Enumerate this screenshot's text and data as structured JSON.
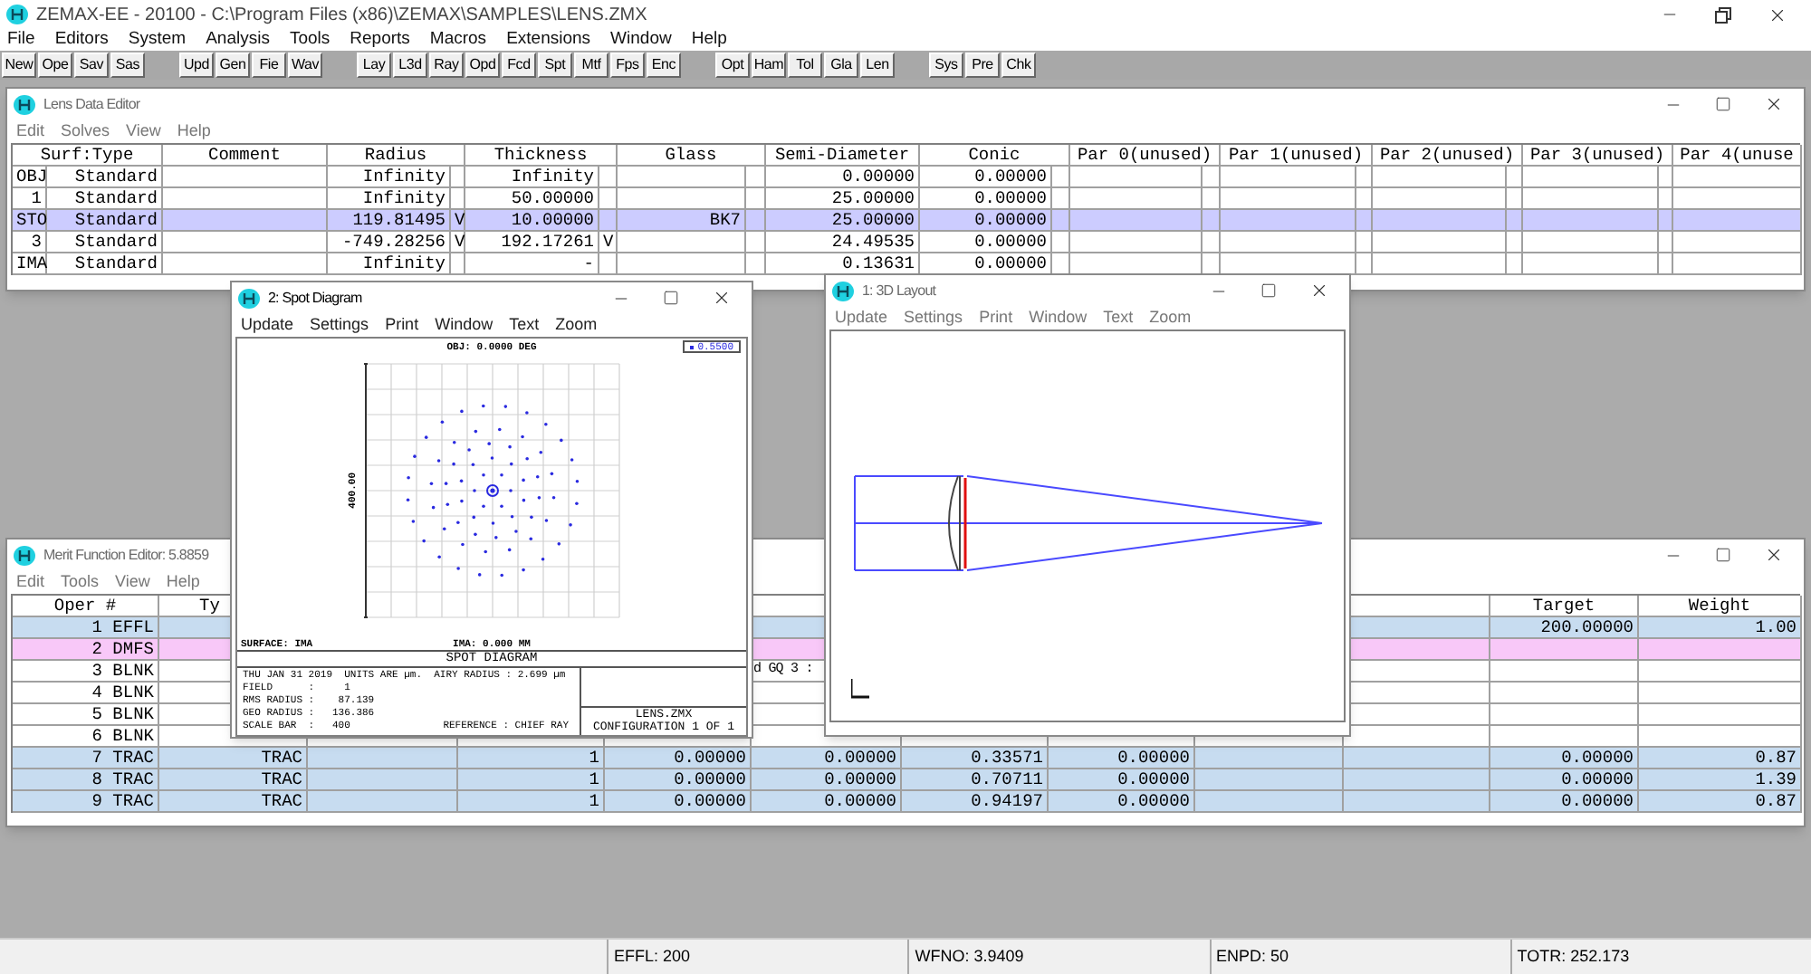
{
  "window": {
    "title": "ZEMAX-EE - 20100 - C:\\Program Files (x86)\\ZEMAX\\SAMPLES\\LENS.ZMX"
  },
  "menu": [
    "File",
    "Editors",
    "System",
    "Analysis",
    "Tools",
    "Reports",
    "Macros",
    "Extensions",
    "Window",
    "Help"
  ],
  "toolbar_groups": [
    {
      "buttons": [
        "New",
        "Ope",
        "Sav",
        "Sas"
      ]
    },
    {
      "buttons": [
        "Upd",
        "Gen",
        "Fie",
        "Wav"
      ]
    },
    {
      "buttons": [
        "Lay",
        "L3d",
        "Ray",
        "Opd",
        "Fcd",
        "Spt",
        "Mtf",
        "Fps",
        "Enc"
      ]
    },
    {
      "buttons": [
        "Opt",
        "Ham",
        "Tol",
        "Gla",
        "Len"
      ]
    },
    {
      "buttons": [
        "Sys",
        "Pre",
        "Chk"
      ]
    }
  ],
  "lens_editor": {
    "title": "Lens Data Editor",
    "active": false,
    "menu": [
      "Edit",
      "Solves",
      "View",
      "Help"
    ],
    "columns": [
      "Surf:Type",
      "Comment",
      "Radius",
      "Thickness",
      "Glass",
      "Semi-Diameter",
      "Conic",
      "Par 0(unused)",
      "Par 1(unused)",
      "Par 2(unused)",
      "Par 3(unused)",
      "Par 4(unuse"
    ],
    "rows": [
      {
        "surface": "OBJ",
        "type": "Standard",
        "radius": "Infinity",
        "thickness": "Infinity",
        "semi_diameter": "0.00000",
        "conic": "0.00000",
        "selected": false
      },
      {
        "surface": "1",
        "type": "Standard",
        "radius": "Infinity",
        "thickness": "50.00000",
        "semi_diameter": "25.00000",
        "conic": "0.00000",
        "selected": false
      },
      {
        "surface": "STO",
        "type": "Standard",
        "radius": "119.81495",
        "radius_solve": "V",
        "thickness": "10.00000",
        "glass": "BK7",
        "semi_diameter": "25.00000",
        "conic": "0.00000",
        "selected": true
      },
      {
        "surface": "3",
        "type": "Standard",
        "radius": "-749.28256",
        "radius_solve": "V",
        "thickness": "192.17261",
        "thickness_solve": "V",
        "semi_diameter": "24.49535",
        "conic": "0.00000",
        "selected": false
      },
      {
        "surface": "IMA",
        "type": "Standard",
        "radius": "Infinity",
        "thickness": "-",
        "semi_diameter": "0.13631",
        "conic": "0.00000",
        "selected": false
      }
    ]
  },
  "merit_editor": {
    "title": "Merit Function Editor: 5.8859",
    "active": false,
    "menu": [
      "Edit",
      "Tools",
      "View",
      "Help"
    ],
    "headers": {
      "oper": "Oper #",
      "type": "Ty",
      "target": "Target",
      "weight": "Weight"
    },
    "rows": [
      {
        "kind": "operand",
        "oper": "1 EFFL",
        "target": "200.00000",
        "weight": "1.00",
        "color": "#c7dcf0"
      },
      {
        "kind": "operand",
        "oper": "2 DMFS",
        "color": "#f8c8f8"
      },
      {
        "kind": "blank",
        "oper": "3 BLNK",
        "column_6": "d GQ 3 :"
      },
      {
        "kind": "blank",
        "oper": "4 BLNK"
      },
      {
        "kind": "blank",
        "oper": "5 BLNK"
      },
      {
        "kind": "blank",
        "oper": "6 BLNK"
      },
      {
        "kind": "operand",
        "oper": "7 TRAC",
        "type": "TRAC",
        "column_4": "1",
        "column_5": "0.00000",
        "column_6": "0.00000",
        "column_7": "0.33571",
        "column_8": "0.00000",
        "target": "0.00000",
        "weight": "0.87",
        "color": "#c7dcf0"
      },
      {
        "kind": "operand",
        "oper": "8 TRAC",
        "type": "TRAC",
        "column_4": "1",
        "column_5": "0.00000",
        "column_6": "0.00000",
        "column_7": "0.70711",
        "column_8": "0.00000",
        "target": "0.00000",
        "weight": "1.39",
        "color": "#c7dcf0"
      },
      {
        "kind": "operand",
        "oper": "9 TRAC",
        "type": "TRAC",
        "column_4": "1",
        "column_5": "0.00000",
        "column_6": "0.00000",
        "column_7": "0.94197",
        "column_8": "0.00000",
        "target": "0.00000",
        "weight": "0.87",
        "color": "#c7dcf0"
      }
    ]
  },
  "spot_diagram": {
    "title": "2: Spot Diagram",
    "active": true,
    "menu": [
      "Update",
      "Settings",
      "Print",
      "Window",
      "Text",
      "Zoom"
    ],
    "object_label": "OBJ: 0.0000 DEG",
    "legend": "0.5500",
    "scale_label": "400.00",
    "surface_label": "SURFACE: IMA",
    "image_label": "IMA: 0.000 MM",
    "plot_title": "SPOT DIAGRAM",
    "info": [
      "THU JAN 31 2019  UNITS ARE µm.  AIRY RADIUS : 2.699 µm",
      "FIELD      :     1",
      "RMS RADIUS :    87.139",
      "GEO RADIUS :   136.386"
    ],
    "scale_bar": "SCALE BAR  :   400",
    "reference": "REFERENCE : CHIEF RAY",
    "file": "LENS.ZMX",
    "configuration": "CONFIGURATION 1 OF 1"
  },
  "layout_3d": {
    "title": "1: 3D Layout",
    "active": false,
    "menu": [
      "Update",
      "Settings",
      "Print",
      "Window",
      "Text",
      "Zoom"
    ]
  },
  "status_bar": [
    "EFFL: 200",
    "WFNO: 3.9409",
    "ENPD: 50",
    "TOTR: 252.173"
  ]
}
